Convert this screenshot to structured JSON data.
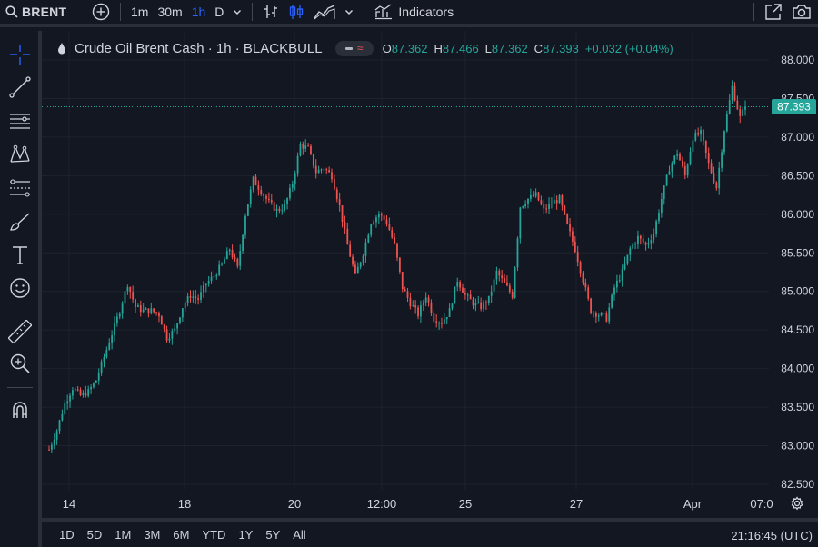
{
  "toolbar": {
    "symbol": "BRENT",
    "intervals": [
      "1m",
      "30m",
      "1h",
      "D"
    ],
    "active_interval": "1h",
    "indicators_label": "Indicators"
  },
  "legend": {
    "title": "Crude Oil Brent Cash · 1h · BLACKBULL",
    "open_key": "O",
    "open": "87.362",
    "high_key": "H",
    "high": "87.466",
    "low_key": "L",
    "low": "87.362",
    "close_key": "C",
    "close": "87.393",
    "change": "+0.032 (+0.04%)",
    "pill_glyph": "≈"
  },
  "bottom": {
    "ranges": [
      "1D",
      "5D",
      "1M",
      "3M",
      "6M",
      "YTD",
      "1Y",
      "5Y",
      "All"
    ],
    "clock": "21:16:45 (UTC)"
  },
  "colors": {
    "up": "#26a69a",
    "down": "#ef5350",
    "accent": "#2962ff",
    "background": "#131722",
    "grid": "#1e222d"
  },
  "chart_data": {
    "type": "candlestick",
    "title": "Crude Oil Brent Cash · 1h · BLACKBULL",
    "ylim": [
      82.5,
      88.0
    ],
    "y_ticks": [
      "88.000",
      "87.500",
      "87.000",
      "86.500",
      "86.000",
      "85.500",
      "85.000",
      "84.500",
      "84.000",
      "83.500",
      "83.000",
      "82.500"
    ],
    "x_ticks": [
      "14",
      "18",
      "20",
      "12:00",
      "25",
      "27",
      "Apr",
      "07:0"
    ],
    "last_price": "87.393",
    "grid": true,
    "path_points": [
      [
        0,
        82.95
      ],
      [
        3,
        83.2
      ],
      [
        6,
        83.55
      ],
      [
        9,
        83.75
      ],
      [
        12,
        83.65
      ],
      [
        15,
        83.7
      ],
      [
        18,
        83.85
      ],
      [
        21,
        84.15
      ],
      [
        24,
        84.45
      ],
      [
        27,
        84.75
      ],
      [
        30,
        85.1
      ],
      [
        33,
        84.8
      ],
      [
        36,
        84.75
      ],
      [
        39,
        84.75
      ],
      [
        42,
        84.7
      ],
      [
        45,
        84.4
      ],
      [
        48,
        84.5
      ],
      [
        51,
        84.8
      ],
      [
        54,
        84.95
      ],
      [
        57,
        84.9
      ],
      [
        60,
        85.1
      ],
      [
        63,
        85.2
      ],
      [
        66,
        85.35
      ],
      [
        69,
        85.55
      ],
      [
        72,
        85.3
      ],
      [
        75,
        86.0
      ],
      [
        78,
        86.45
      ],
      [
        81,
        86.3
      ],
      [
        84,
        86.15
      ],
      [
        87,
        86.05
      ],
      [
        90,
        86.1
      ],
      [
        93,
        86.4
      ],
      [
        96,
        86.9
      ],
      [
        99,
        86.85
      ],
      [
        102,
        86.55
      ],
      [
        105,
        86.6
      ],
      [
        108,
        86.5
      ],
      [
        111,
        86.1
      ],
      [
        114,
        85.6
      ],
      [
        117,
        85.2
      ],
      [
        120,
        85.5
      ],
      [
        123,
        85.9
      ],
      [
        126,
        86.0
      ],
      [
        129,
        85.9
      ],
      [
        132,
        85.6
      ],
      [
        135,
        85.05
      ],
      [
        138,
        84.85
      ],
      [
        141,
        84.7
      ],
      [
        144,
        84.95
      ],
      [
        147,
        84.65
      ],
      [
        150,
        84.6
      ],
      [
        153,
        84.75
      ],
      [
        156,
        85.15
      ],
      [
        159,
        84.95
      ],
      [
        162,
        84.85
      ],
      [
        165,
        84.8
      ],
      [
        168,
        84.9
      ],
      [
        171,
        85.25
      ],
      [
        174,
        85.1
      ],
      [
        177,
        84.95
      ],
      [
        180,
        86.1
      ],
      [
        183,
        86.2
      ],
      [
        186,
        86.25
      ],
      [
        189,
        86.05
      ],
      [
        192,
        86.15
      ],
      [
        195,
        86.2
      ],
      [
        198,
        85.85
      ],
      [
        201,
        85.55
      ],
      [
        204,
        85.15
      ],
      [
        207,
        84.75
      ],
      [
        210,
        84.7
      ],
      [
        213,
        84.65
      ],
      [
        216,
        85.05
      ],
      [
        219,
        85.25
      ],
      [
        222,
        85.55
      ],
      [
        225,
        85.7
      ],
      [
        228,
        85.6
      ],
      [
        231,
        85.75
      ],
      [
        234,
        86.2
      ],
      [
        237,
        86.6
      ],
      [
        240,
        86.8
      ],
      [
        243,
        86.5
      ],
      [
        246,
        87.0
      ],
      [
        249,
        87.05
      ],
      [
        252,
        86.65
      ],
      [
        255,
        86.35
      ],
      [
        258,
        87.1
      ],
      [
        261,
        87.65
      ],
      [
        264,
        87.25
      ],
      [
        266,
        87.393
      ]
    ]
  }
}
